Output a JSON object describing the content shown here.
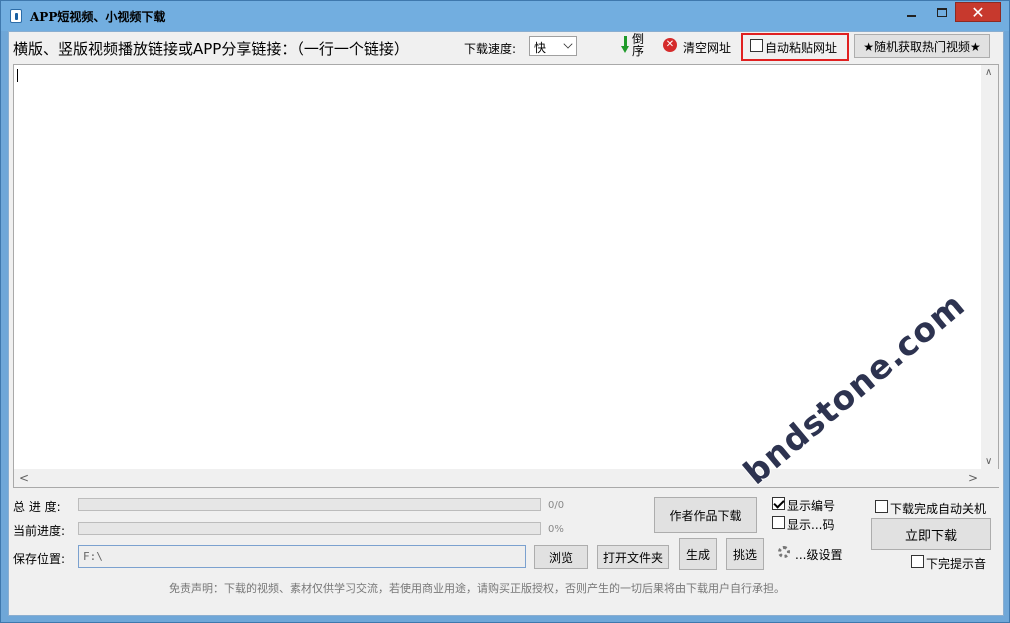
{
  "window": {
    "title": "APP短视频、小视频下载"
  },
  "toolbar": {
    "main_label": "横版、竖版视频播放链接或APP分享链接：（一行一个链接）",
    "speed_label": "下载速度:",
    "speed_value": "快",
    "reverse_label": "倒序",
    "clear_label": "清空网址",
    "auto_paste_label": "自动粘贴网址",
    "random_hot_label": "★随机获取热门视频★"
  },
  "link_input": {
    "value": ""
  },
  "progress": {
    "total_label": "总 进 度:",
    "total_value": "0/0",
    "total_fraction": 0,
    "current_label": "当前进度:",
    "current_value": "0%",
    "current_fraction": 0
  },
  "save": {
    "label": "保存位置:",
    "path": "F:\\",
    "browse_label": "浏览",
    "open_folder_label": "打开文件夹"
  },
  "actions": {
    "author_works_label": "作者作品下载",
    "generate_label": "生成",
    "pick_label": "挑选",
    "show_number_label": "显示编号",
    "show_number_checked": true,
    "show_code_label": "显示...码",
    "show_code_checked": false,
    "advanced_label": "...级设置",
    "shutdown_label": "下载完成自动关机",
    "shutdown_checked": false,
    "download_now_label": "立即下载",
    "sound_label": "下完提示音",
    "sound_checked": false
  },
  "footer": {
    "disclaimer": "免责声明：下载的视频、素材仅供学习交流，若使用商业用途，请购买正版授权，否则产生的一切后果将由下载用户自行承担。"
  },
  "watermark": "bndstone.com",
  "colors": {
    "titlebar": "#72aee0",
    "close_button": "#c7392d",
    "highlight_box": "#e02020",
    "reverse_arrow": "#1f9a2a",
    "clear_icon": "#d52b2b"
  }
}
